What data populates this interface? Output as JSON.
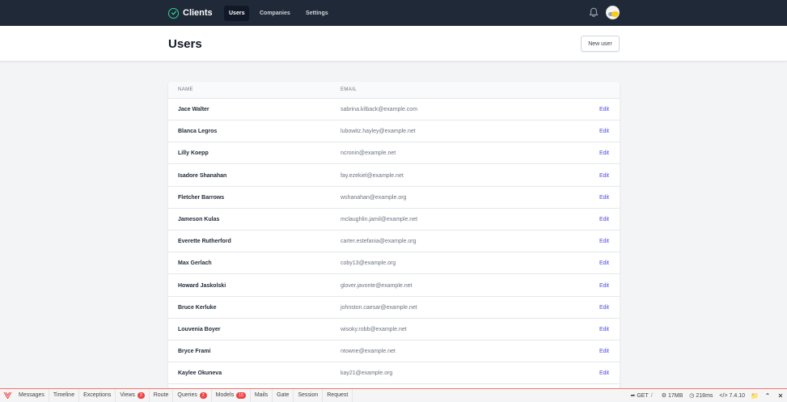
{
  "nav": {
    "brand": "Clients",
    "links": [
      {
        "label": "Users",
        "active": true
      },
      {
        "label": "Companies",
        "active": false
      },
      {
        "label": "Settings",
        "active": false
      }
    ]
  },
  "header": {
    "title": "Users",
    "new_user_label": "New user"
  },
  "table": {
    "columns": [
      "NAME",
      "EMAIL"
    ],
    "edit_label": "Edit",
    "rows": [
      {
        "name": "Jace Walter",
        "email": "sabrina.kilback@example.com"
      },
      {
        "name": "Blanca Legros",
        "email": "lubowitz.hayley@example.net"
      },
      {
        "name": "Lilly Koepp",
        "email": "ncronin@example.net"
      },
      {
        "name": "Isadore Shanahan",
        "email": "fay.ezekiel@example.net"
      },
      {
        "name": "Fletcher Barrows",
        "email": "wshanahan@example.org"
      },
      {
        "name": "Jameson Kulas",
        "email": "mclaughlin.jamil@example.net"
      },
      {
        "name": "Everette Rutherford",
        "email": "carter.estefania@example.org"
      },
      {
        "name": "Max Gerlach",
        "email": "coby13@example.org"
      },
      {
        "name": "Howard Jaskolski",
        "email": "glover.javonte@example.net"
      },
      {
        "name": "Bruce Kerluke",
        "email": "johnston.caesar@example.net"
      },
      {
        "name": "Louvenia Boyer",
        "email": "wisoky.robb@example.net"
      },
      {
        "name": "Bryce Frami",
        "email": "ntowne@example.net"
      },
      {
        "name": "Kaylee Okuneva",
        "email": "kay21@example.org"
      }
    ]
  },
  "debugbar": {
    "tabs": [
      {
        "label": "Messages",
        "badge": null
      },
      {
        "label": "Timeline",
        "badge": null
      },
      {
        "label": "Exceptions",
        "badge": null
      },
      {
        "label": "Views",
        "badge": "3"
      },
      {
        "label": "Route",
        "badge": null
      },
      {
        "label": "Queries",
        "badge": "2"
      },
      {
        "label": "Models",
        "badge": "15"
      },
      {
        "label": "Mails",
        "badge": null
      },
      {
        "label": "Gate",
        "badge": null
      },
      {
        "label": "Session",
        "badge": null
      },
      {
        "label": "Request",
        "badge": null
      }
    ],
    "method": "GET",
    "route": "/",
    "memory": "17MB",
    "time": "218ms",
    "version": "7.4.10"
  },
  "colors": {
    "nav_bg": "#1f2937",
    "brand_accent": "#34d399",
    "link": "#4f46e5",
    "debug_badge": "#ef4444"
  },
  "icons": [
    "check-circle-icon",
    "bell-icon",
    "folder-icon",
    "chevron-up-icon",
    "close-icon",
    "share-icon",
    "cogs-icon",
    "clock-icon",
    "code-icon"
  ]
}
